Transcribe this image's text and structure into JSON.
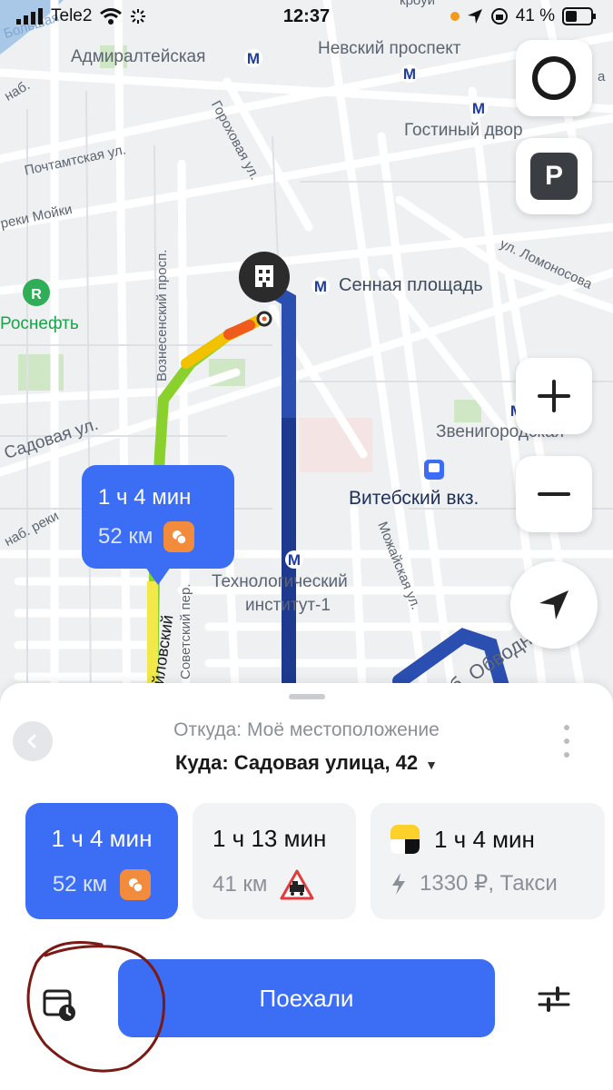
{
  "status_bar": {
    "carrier": "Tele2",
    "time": "12:37",
    "battery": "41 %"
  },
  "map": {
    "labels": {
      "admiralteyskaya": "Адмиралтейская",
      "nevsky": "Невский проспект",
      "gostiny": "Гостиный двор",
      "pochtamtskaya": "Почтамтская ул.",
      "reki_moyki": "реки Мойки",
      "gorokhovaya": "Гороховая ул.",
      "voznesensky": "Вознесенский просп.",
      "sennaya": "Сенная площадь",
      "lomonosova": "ул. Ломоносова",
      "rosneft": "Роснефть",
      "sadovaya": "Садовая ул.",
      "zvenigorodskaya": "Звенигородская",
      "vitebsky": "Витебский вкз.",
      "naberezhnaya": "наб. реки",
      "tekhnolog_1": "Технологический",
      "tekhnolog_2": "институт-1",
      "mozhayskaya": "Можайская ул.",
      "sovetsky": "Советский пер.",
      "izmaylovsky": "йловский",
      "obvodny": "наб. Обводного",
      "top_cut": "кроуи",
      "boot_cut": "Большая",
      "nab_cut": "наб.",
      "a_cut": "а"
    },
    "buttons": {
      "parking": "P"
    },
    "bubble": {
      "time": "1 ч 4 мин",
      "distance": "52 км"
    }
  },
  "sheet": {
    "from": "Откуда: Моё местоположение",
    "to": "Куда: Садовая улица, 42",
    "options": [
      {
        "time": "1 ч 4 мин",
        "detail": "52 км",
        "icon": "toll-road-icon"
      },
      {
        "time": "1 ч 13 мин",
        "detail": "41 км",
        "icon": "railway-crossing-icon"
      },
      {
        "time": "1 ч 4 мин",
        "detail": "1330 ₽, Такси",
        "icon": "taxi-icon"
      }
    ],
    "go_label": "Поехали"
  },
  "colors": {
    "accent": "#3b6ef5",
    "route_dark": "#2a4fb0",
    "annotation": "#7a1a14"
  }
}
